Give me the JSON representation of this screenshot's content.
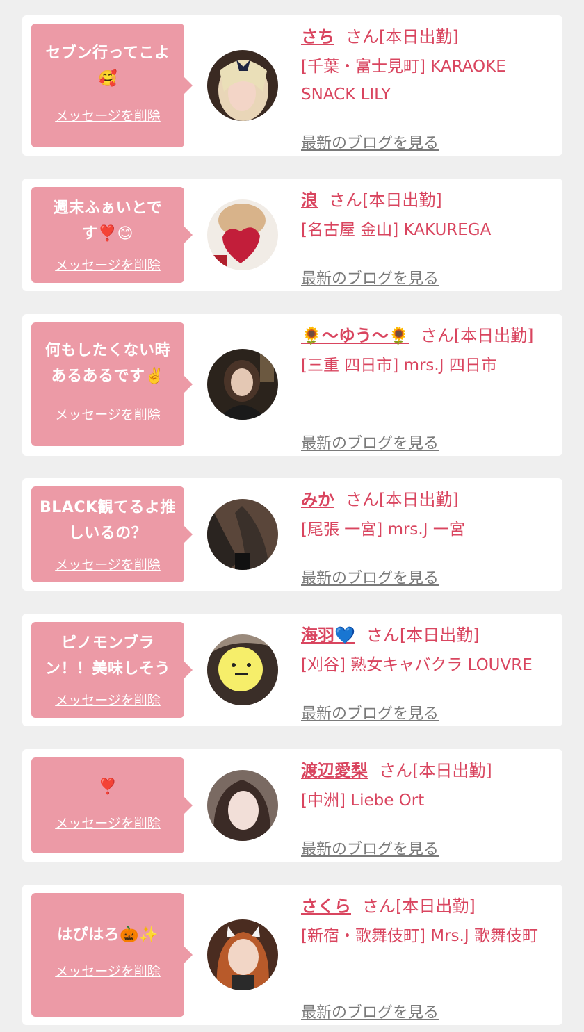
{
  "cards": [
    {
      "message": "セブン行ってこよ🥰",
      "delete_label": "メッセージを削除",
      "name": "さち",
      "suffix": "さん[本日出勤]",
      "shop": "[千葉・富士見町] KARAOKE SNACK LILY",
      "blog_link": "最新のブログを見る",
      "avatar_icon": "profile-photo"
    },
    {
      "message": "週末ふぁいとです❣️😊",
      "delete_label": "メッセージを削除",
      "name": "浪",
      "suffix": "さん[本日出勤]",
      "shop": "[名古屋 金山] KAKUREGA",
      "blog_link": "最新のブログを見る",
      "avatar_icon": "profile-photo"
    },
    {
      "message": "何もしたくない時あるあるです✌️",
      "delete_label": "メッセージを削除",
      "name": "🌻〜ゆう〜🌻",
      "suffix": "さん[本日出勤]",
      "shop": "[三重 四日市] mrs.J 四日市",
      "blog_link": "最新のブログを見る",
      "avatar_icon": "profile-photo"
    },
    {
      "message": "BLACK観てるよ推しいるの？",
      "delete_label": "メッセージを削除",
      "name": "みか",
      "suffix": "さん[本日出勤]",
      "shop": "[尾張 一宮] mrs.J 一宮",
      "blog_link": "最新のブログを見る",
      "avatar_icon": "profile-photo"
    },
    {
      "message": "ピノモンブラン！！美味しそう",
      "delete_label": "メッセージを削除",
      "name": "海羽💙",
      "suffix": "さん[本日出勤]",
      "shop": "[刈谷] 熟女キャバクラ LOUVRE",
      "blog_link": "最新のブログを見る",
      "avatar_icon": "profile-photo"
    },
    {
      "message": "❣️",
      "delete_label": "メッセージを削除",
      "name": "渡辺愛梨",
      "suffix": "さん[本日出勤]",
      "shop": "[中洲] Liebe Ort",
      "blog_link": "最新のブログを見る",
      "avatar_icon": "profile-photo"
    },
    {
      "message": "はぴはろ🎃✨",
      "delete_label": "メッセージを削除",
      "name": "さくら",
      "suffix": "さん[本日出勤]",
      "shop": "[新宿・歌舞伎町] Mrs.J 歌舞伎町",
      "blog_link": "最新のブログを見る",
      "avatar_icon": "profile-photo"
    }
  ],
  "colors": {
    "bubble": "#ec9aa6",
    "accent": "#d9455f",
    "link_gray": "#7a7a7a",
    "background": "#efefef"
  }
}
